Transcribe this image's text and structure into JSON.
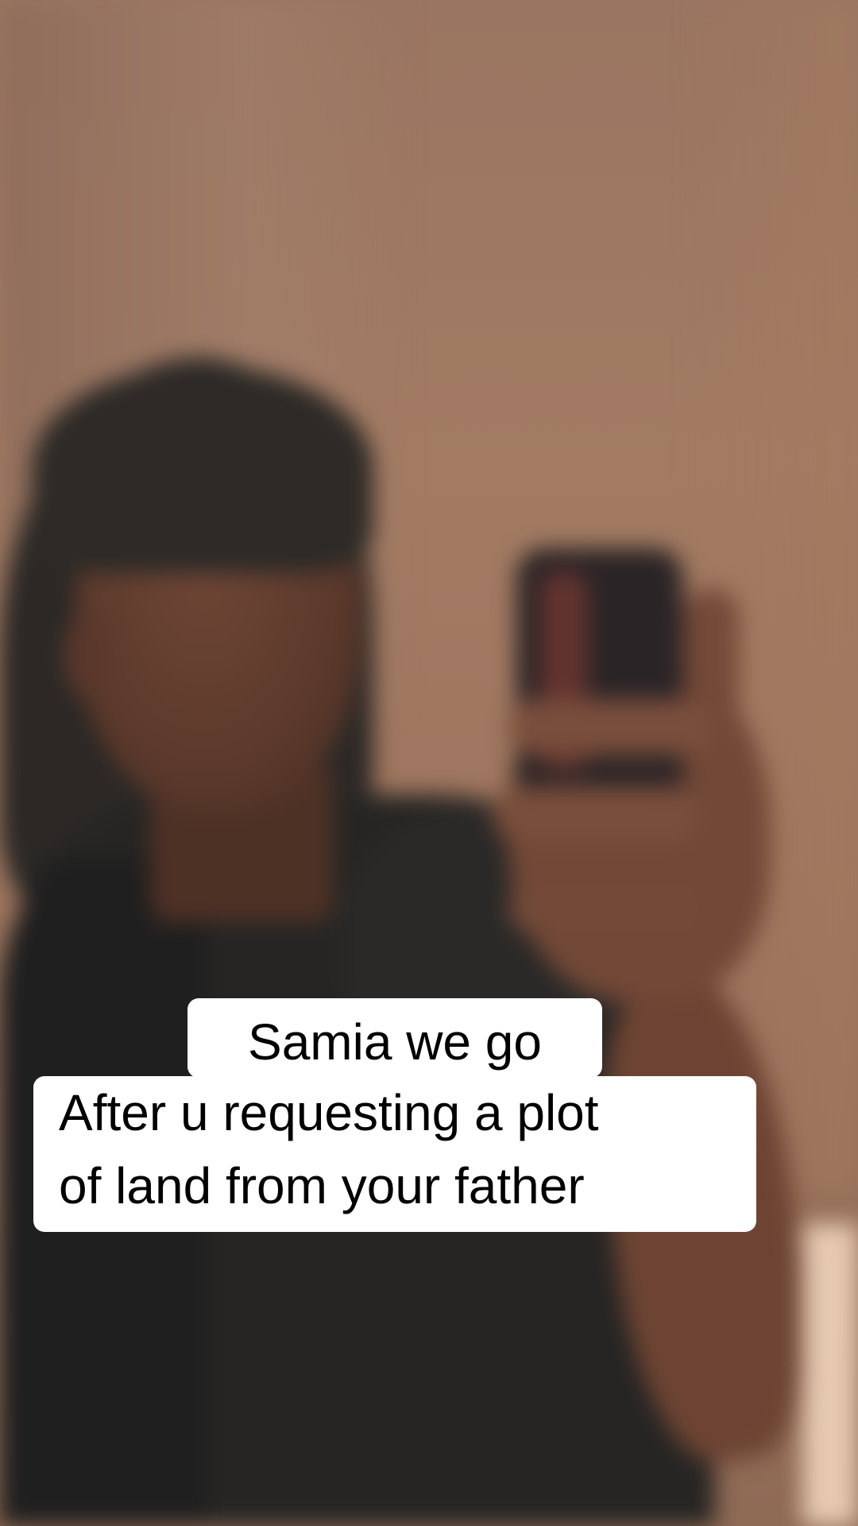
{
  "caption": {
    "top_line": "Samia we go",
    "main_lines": [
      "After u requesting a plot",
      "of land from your father"
    ]
  },
  "colors": {
    "wall": "#a37b63",
    "caption_bg": "#ffffff",
    "caption_text": "#000000"
  }
}
